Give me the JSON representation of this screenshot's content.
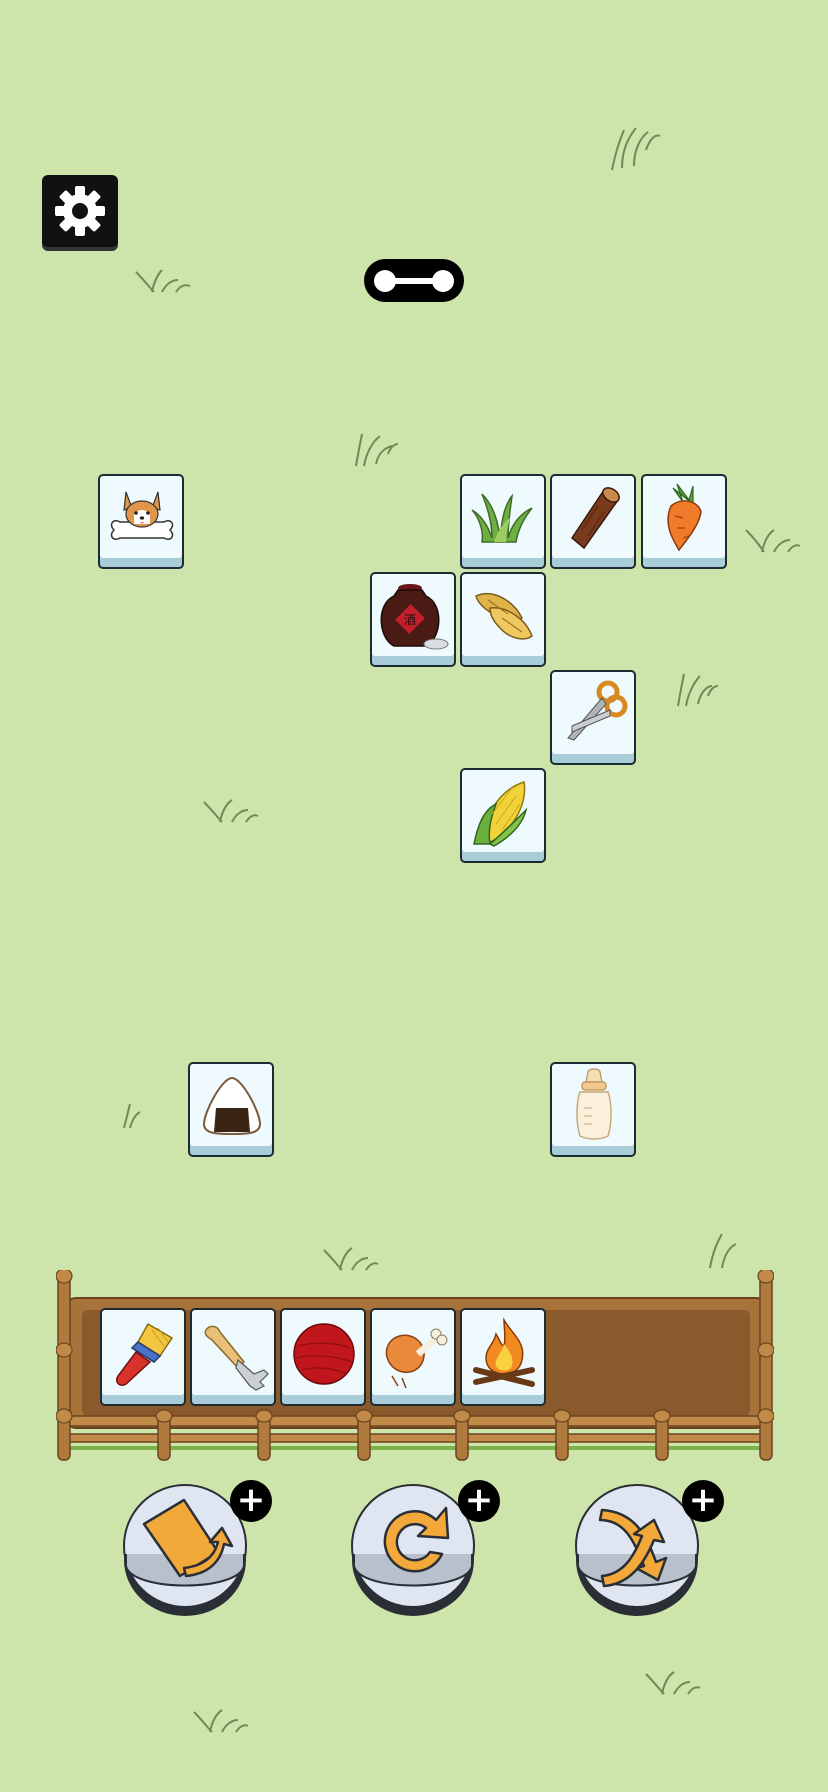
{
  "game": {
    "board_tiles": [
      {
        "id": "corgi",
        "icon": "corgi-bone-icon"
      },
      {
        "id": "grass",
        "icon": "grass-tuft-icon"
      },
      {
        "id": "log",
        "icon": "wood-log-icon"
      },
      {
        "id": "carrot",
        "icon": "carrot-icon"
      },
      {
        "id": "wine-jar",
        "icon": "wine-jar-icon"
      },
      {
        "id": "bamboo",
        "icon": "bamboo-shoot-icon"
      },
      {
        "id": "scissors",
        "icon": "scissors-icon"
      },
      {
        "id": "corn",
        "icon": "corn-icon"
      },
      {
        "id": "onigiri",
        "icon": "rice-ball-icon"
      },
      {
        "id": "bottle",
        "icon": "baby-bottle-icon"
      }
    ],
    "tray": {
      "slot_count": 7,
      "filled": [
        {
          "id": "brush",
          "icon": "paint-brush-icon"
        },
        {
          "id": "fork",
          "icon": "fork-icon"
        },
        {
          "id": "yarn",
          "icon": "yarn-ball-icon"
        },
        {
          "id": "drumstick",
          "icon": "chicken-leg-icon"
        },
        {
          "id": "campfire",
          "icon": "campfire-icon"
        }
      ]
    },
    "powerups": [
      {
        "id": "move-out",
        "icon": "card-move-icon",
        "badge": "+"
      },
      {
        "id": "undo",
        "icon": "undo-arrow-icon",
        "badge": "+"
      },
      {
        "id": "shuffle",
        "icon": "shuffle-icon",
        "badge": "+"
      }
    ],
    "colors": {
      "background": "#cde4ab",
      "tile": "#eefafd",
      "tile_shadow": "#a8ccd8",
      "powerup_orange": "#f3a93a",
      "fence": "#a8733a"
    }
  }
}
